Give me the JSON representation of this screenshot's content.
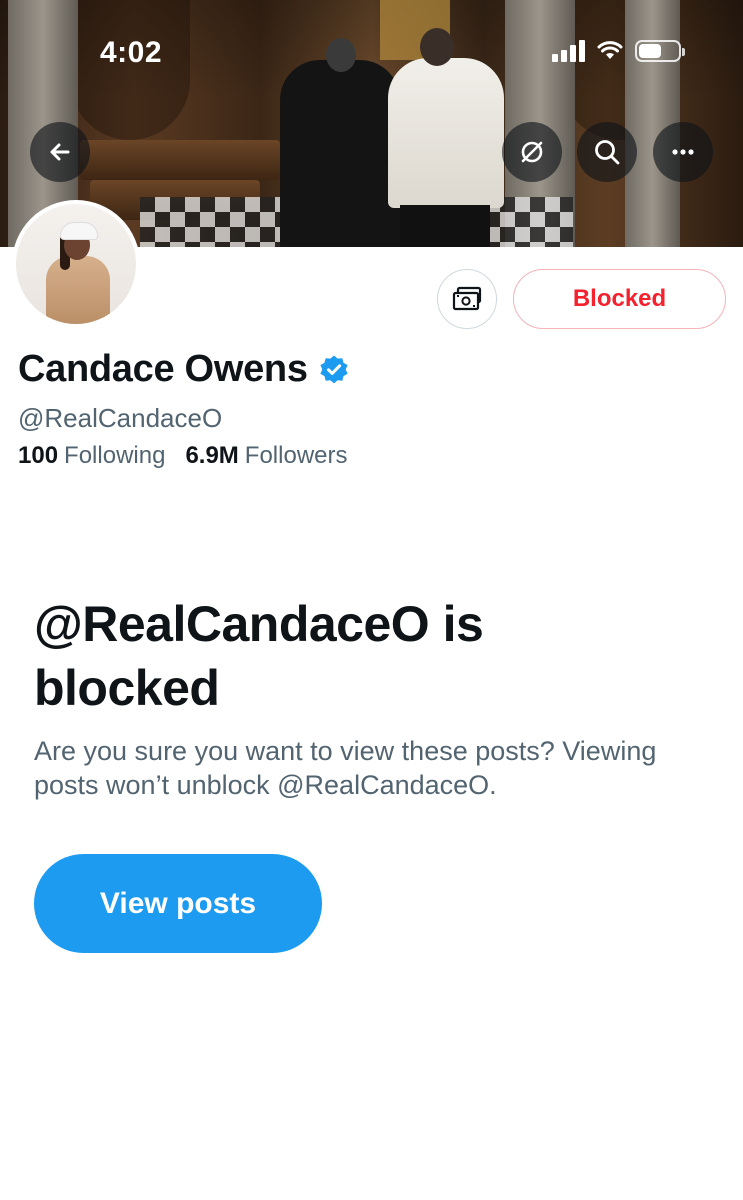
{
  "status_bar": {
    "time": "4:02"
  },
  "header": {
    "back_icon": "arrow-left-icon",
    "actions": [
      "translate-icon",
      "search-icon",
      "more-icon"
    ]
  },
  "profile": {
    "display_name": "Candace Owens",
    "verified": true,
    "handle": "@RealCandaceO",
    "following_count": "100",
    "following_label": "Following",
    "followers_count": "6.9M",
    "followers_label": "Followers"
  },
  "actions": {
    "tip_icon": "money-icon",
    "blocked_label": "Blocked"
  },
  "blocked_notice": {
    "title": "@RealCandaceO is blocked",
    "description": "Are you sure you want to view these posts? Viewing posts won’t unblock @RealCandaceO.",
    "button_label": "View posts"
  },
  "colors": {
    "accent": "#1d9bf0",
    "danger": "#f4212e",
    "text_primary": "#0f1419",
    "text_secondary": "#536471"
  }
}
